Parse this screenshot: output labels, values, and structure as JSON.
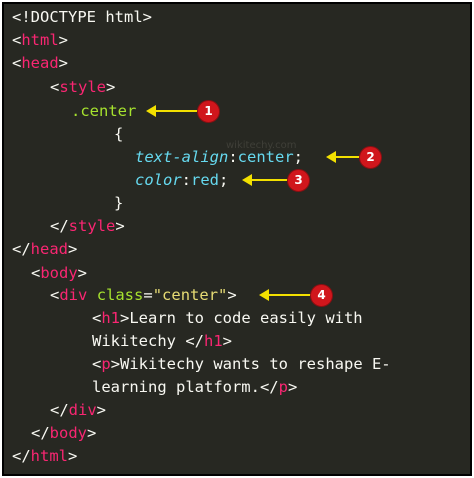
{
  "code": {
    "l1": "<!DOCTYPE html>",
    "l2_open": "<",
    "l2_tag": "html",
    "l2_close": ">",
    "l3_open": "<",
    "l3_tag": "head",
    "l3_close": ">",
    "l4_open": "<",
    "l4_tag": "style",
    "l4_close": ">",
    "l5": ".center",
    "l6": "{",
    "l7_prop": "text-align",
    "l7_colon": ":",
    "l7_val": "center",
    "l7_semi": ";",
    "l8_prop": "color",
    "l8_colon": ":",
    "l8_val": "red",
    "l8_semi": ";",
    "l9": "}",
    "l10_open": "</",
    "l10_tag": "style",
    "l10_close": ">",
    "l11_open": "</",
    "l11_tag": "head",
    "l11_close": ">",
    "l12_open": "<",
    "l12_tag": "body",
    "l12_close": ">",
    "l13_open": "<",
    "l13_tag": "div",
    "l13_attr": "class",
    "l13_eq": "=",
    "l13_str": "\"center\"",
    "l13_close": ">",
    "l14_open": "<",
    "l14_tag": "h1",
    "l14_text": ">Learn to code easily with",
    "l15_text": "Wikitechy </",
    "l15_tag": "h1",
    "l15_close": ">",
    "l16_open": "<",
    "l16_tag": "p",
    "l16_text": ">Wikitechy wants to reshape E-",
    "l17_text": "learning platform.</",
    "l17_tag": "p",
    "l17_close": ">",
    "l18_open": "</",
    "l18_tag": "div",
    "l18_close": ">",
    "l19_open": "</",
    "l19_tag": "body",
    "l19_close": ">",
    "l20_open": "</",
    "l20_tag": "html",
    "l20_close": ">"
  },
  "watermark": "wikitechy.com",
  "callouts": [
    "1",
    "2",
    "3",
    "4"
  ],
  "colors": {
    "background": "#272822",
    "tag": "#f92672",
    "attribute": "#a6e22e",
    "string": "#e6db74",
    "property": "#66d9ef",
    "text": "#f8f8f2",
    "arrow": "#f2e000",
    "badge": "#d0161c"
  }
}
